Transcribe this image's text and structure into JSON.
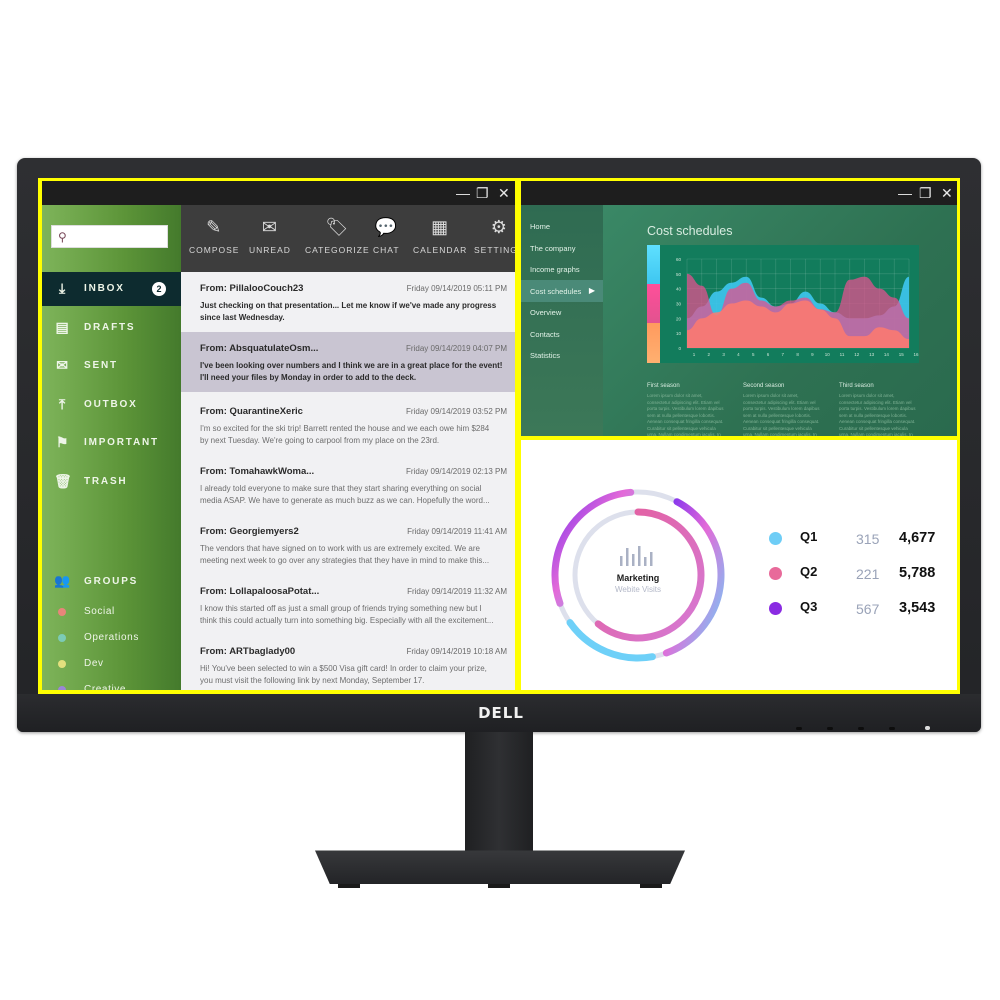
{
  "monitor": {
    "brand": "DELL"
  },
  "mail_window": {
    "controls": {
      "minimize": "—",
      "restore": "❐",
      "close": "✕"
    },
    "search": {
      "placeholder": "",
      "icon": "search-icon"
    },
    "toolbar": [
      {
        "label": "COMPOSE",
        "icon": "pencil-icon",
        "glyph": "✎"
      },
      {
        "label": "UNREAD",
        "icon": "envelope-icon",
        "glyph": "✉"
      },
      {
        "label": "CATEGORIZE",
        "icon": "tag-icon",
        "glyph": "🏷"
      },
      {
        "label": "CHAT",
        "icon": "chat-icon",
        "glyph": "💬"
      },
      {
        "label": "CALENDAR",
        "icon": "calendar-icon",
        "glyph": "▦"
      },
      {
        "label": "SETTINGS",
        "icon": "gear-icon",
        "glyph": "⚙"
      }
    ],
    "folders": [
      {
        "label": "INBOX",
        "icon": "inbox-icon",
        "glyph": "⤓",
        "badge": "2",
        "active": true
      },
      {
        "label": "DRAFTS",
        "icon": "document-icon",
        "glyph": "▤"
      },
      {
        "label": "SENT",
        "icon": "sent-icon",
        "glyph": "✉"
      },
      {
        "label": "OUTBOX",
        "icon": "outbox-icon",
        "glyph": "⤒"
      },
      {
        "label": "IMPORTANT",
        "icon": "flag-icon",
        "glyph": "⚑"
      },
      {
        "label": "TRASH",
        "icon": "trash-icon",
        "glyph": "🗑"
      }
    ],
    "groups": {
      "label": "GROUPS",
      "icon": "users-icon",
      "items": [
        {
          "label": "Social",
          "color": "#e8857a"
        },
        {
          "label": "Operations",
          "color": "#7ccbb6"
        },
        {
          "label": "Dev",
          "color": "#e3e07e"
        },
        {
          "label": "Creative",
          "color": "#9b86d6"
        }
      ]
    },
    "messages": [
      {
        "from": "From: PillalooCouch23",
        "date": "Friday 09/14/2019 05:11 PM",
        "body": [
          "Just checking on that presentation... Let me know if we've made any progress",
          "since last Wednesday."
        ],
        "unread": true,
        "selected": false
      },
      {
        "from": "From: AbsquatulateOsm...",
        "date": "Friday 09/14/2019 04:07 PM",
        "body": [
          "I've been looking over numbers and I think we are in a great place for the event!",
          "I'll need your files by Monday in order to add to the deck."
        ],
        "unread": true,
        "selected": true
      },
      {
        "from": "From: QuarantineXeric",
        "date": "Friday 09/14/2019 03:52 PM",
        "body": [
          "I'm so excited for the ski trip! Barrett rented the house and we each owe him $284",
          "by next Tuesday. We're going to carpool from my place on the 23rd."
        ],
        "unread": false,
        "selected": false
      },
      {
        "from": "From: TomahawkWoma...",
        "date": "Friday 09/14/2019 02:13 PM",
        "body": [
          "I already told everyone to make sure that they start sharing everything on social",
          "media ASAP. We have to generate as much buzz as we can. Hopefully the word..."
        ],
        "unread": false,
        "selected": false
      },
      {
        "from": "From: Georgiemyers2",
        "date": "Friday 09/14/2019 11:41 AM",
        "body": [
          "The vendors that have signed on to work with us are extremely excited. We are",
          "meeting next week to go over any strategies that they have in mind to make this..."
        ],
        "unread": false,
        "selected": false
      },
      {
        "from": "From: LollapaloosaPotat...",
        "date": "Friday 09/14/2019 11:32 AM",
        "body": [
          "I know this started off as just a small group of friends trying something new but I",
          "think this could actually turn into something big. Especially with all the excitement..."
        ],
        "unread": false,
        "selected": false
      },
      {
        "from": "From: ARTbaglady00",
        "date": "Friday 09/14/2019 10:18 AM",
        "body": [
          "Hi! You've been selected to win a $500 Visa gift card! In order to claim your prize,",
          "you must visit the following link by next Monday, September 17."
        ],
        "unread": false,
        "selected": false
      }
    ]
  },
  "cost_window": {
    "controls": {
      "minimize": "—",
      "restore": "❐",
      "close": "✕"
    },
    "nav": [
      {
        "label": "Home"
      },
      {
        "label": "The company"
      },
      {
        "label": "Income graphs"
      },
      {
        "label": "Cost schedules",
        "active": true,
        "arrow": "▶"
      },
      {
        "label": "Overview"
      },
      {
        "label": "Contacts"
      },
      {
        "label": "Statistics"
      }
    ],
    "title": "Cost schedules",
    "seasons": [
      {
        "title": "First season",
        "body": "Lorem ipsum dolor sit amet, consectetur adipiscing elit. Etiam vel porta turpis. Vestibulum lorem dapibus sem at nulla pellentesque lobortis. Aenean consequat fringilla consequat. Curabitur sit pellentesque vehicula urna. Nullam condimentum iaculis. In hac habitasse platea dictumst. Fusce porta mauris tincidunt. Nulla tincidunt tellus eget nisi pretium, ac laoreet metus mattis. Nulla orci."
      },
      {
        "title": "Second season",
        "body": "Lorem ipsum dolor sit amet, consectetur adipiscing elit. Etiam vel porta turpis. Vestibulum lorem dapibus sem at nulla pellentesque lobortis. Aenean consequat fringilla consequat. Curabitur sit pellentesque vehicula urna. Nullam condimentum iaculis. In hac habitasse platea dictumst. Fusce porta mauris tincidunt. Nulla tincidunt tellus eget nisi pretium, ac laoreet metus mattis. Nulla orci."
      },
      {
        "title": "Third season",
        "body": "Lorem ipsum dolor sit amet, consectetur adipiscing elit. Etiam vel porta turpis. Vestibulum lorem dapibus sem at nulla pellentesque lobortis. Aenean consequat fringilla consequat. Curabitur sit pellentesque vehicula urna. Nullam condimentum iaculis. In hac habitasse platea dictumst. Fusce porta mauris tincidunt. Nulla tincidunt tellus eget nisi pretium, ac laoreet metus mattis. Nulla orci."
      }
    ]
  },
  "marketing_window": {
    "title": "Marketing",
    "subtitle": "Webite Visits",
    "rows": [
      {
        "label": "Q1",
        "value_a": "315",
        "value_b": "4,677",
        "color": "#6ecdf6"
      },
      {
        "label": "Q2",
        "value_a": "221",
        "value_b": "5,788",
        "color": "#e86a9a"
      },
      {
        "label": "Q3",
        "value_a": "567",
        "value_b": "3,543",
        "color": "#8a2be2"
      }
    ],
    "ring_fractions": {
      "outer": 0.78,
      "inner": 0.72
    }
  },
  "chart_data": [
    {
      "type": "area",
      "title": "Cost schedules",
      "x": [
        1,
        2,
        3,
        4,
        5,
        6,
        7,
        8,
        9,
        10,
        11,
        12,
        13,
        14,
        15,
        16
      ],
      "ylim": [
        0,
        60
      ],
      "yticks": [
        0,
        10,
        20,
        30,
        40,
        50,
        60
      ],
      "grid": true,
      "series": [
        {
          "name": "cyan",
          "color": "#3ec6f0",
          "values": [
            20,
            28,
            38,
            44,
            48,
            34,
            28,
            30,
            38,
            30,
            24,
            20,
            20,
            22,
            28,
            48
          ]
        },
        {
          "name": "pink",
          "color": "#e2528f",
          "values": [
            50,
            42,
            22,
            40,
            44,
            32,
            28,
            32,
            34,
            26,
            24,
            46,
            48,
            40,
            34,
            20
          ]
        },
        {
          "name": "orange",
          "color": "#ff7a6e",
          "values": [
            12,
            20,
            24,
            30,
            32,
            28,
            24,
            30,
            32,
            26,
            20,
            8,
            8,
            14,
            12,
            6
          ]
        }
      ]
    }
  ]
}
